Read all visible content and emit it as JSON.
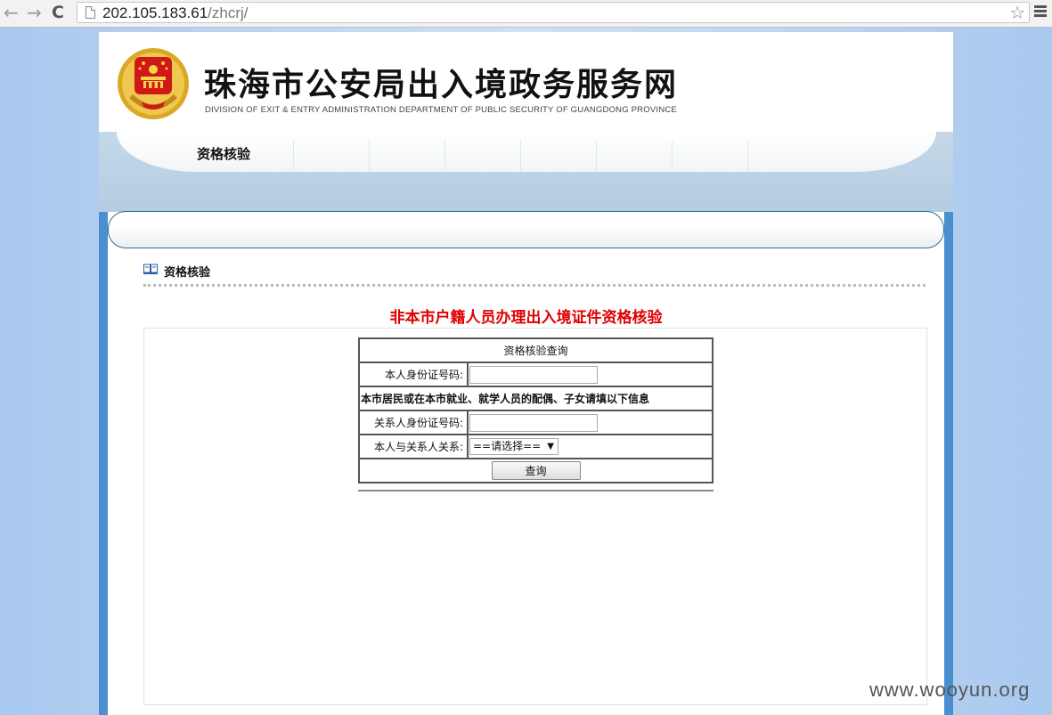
{
  "browser": {
    "back_icon": "←",
    "forward_icon": "→",
    "reload_icon": "C",
    "url_host": "202.105.183.61",
    "url_path": "/zhcrj/",
    "star_icon": "☆"
  },
  "header": {
    "title": "珠海市公安局出入境政务服务网",
    "subtitle": "DIVISION OF EXIT & ENTRY ADMINISTRATION DEPARTMENT OF PUBLIC SECURITY OF GUANGDONG PROVINCE"
  },
  "nav": {
    "tabs": [
      {
        "label": "资格核验"
      }
    ]
  },
  "section": {
    "title": "资格核验"
  },
  "main": {
    "heading": "非本市户籍人员办理出入境证件资格核验"
  },
  "form": {
    "caption": "资格核验查询",
    "id_label": "本人身份证号码:",
    "id_value": "",
    "note": "本市居民或在本市就业、就学人员的配偶、子女请填以下信息",
    "relative_id_label": "关系人身份证号码:",
    "relative_id_value": "",
    "relation_label": "本人与关系人关系:",
    "relation_selected": "==请选择==",
    "submit_label": "查询"
  },
  "watermark": "www.wooyun.org",
  "colors": {
    "heading_red": "#e00000",
    "page_blue": "#4a8fcf"
  }
}
